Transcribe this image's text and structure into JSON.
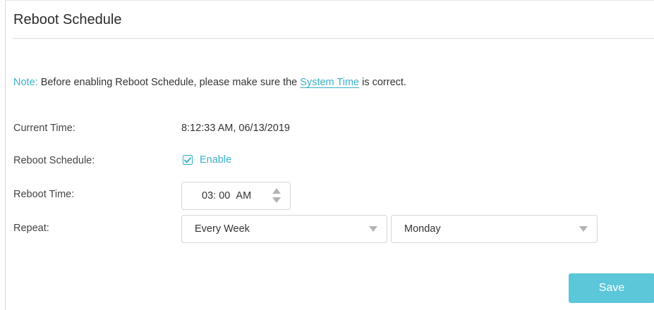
{
  "page": {
    "title": "Reboot Schedule"
  },
  "note": {
    "label": "Note:",
    "text_before": " Before enabling Reboot Schedule, please make sure the ",
    "link": "System Time",
    "text_after": " is correct."
  },
  "fields": {
    "current_time": {
      "label": "Current Time:",
      "value": "8:12:33 AM, 06/13/2019"
    },
    "reboot_schedule": {
      "label": "Reboot Schedule:",
      "checkbox_label": "Enable",
      "checked": true
    },
    "reboot_time": {
      "label": "Reboot Time:",
      "hour": "03",
      "minute": "00",
      "ampm": "AM"
    },
    "repeat": {
      "label": "Repeat:",
      "frequency": "Every Week",
      "day": "Monday"
    }
  },
  "actions": {
    "save_label": "Save"
  },
  "colors": {
    "accent": "#3ab0c9",
    "button": "#5bc7d9"
  },
  "icons": {
    "checkbox": "checkmark-icon",
    "spinner": "up-down-arrows-icon",
    "dropdown": "caret-down-icon"
  }
}
